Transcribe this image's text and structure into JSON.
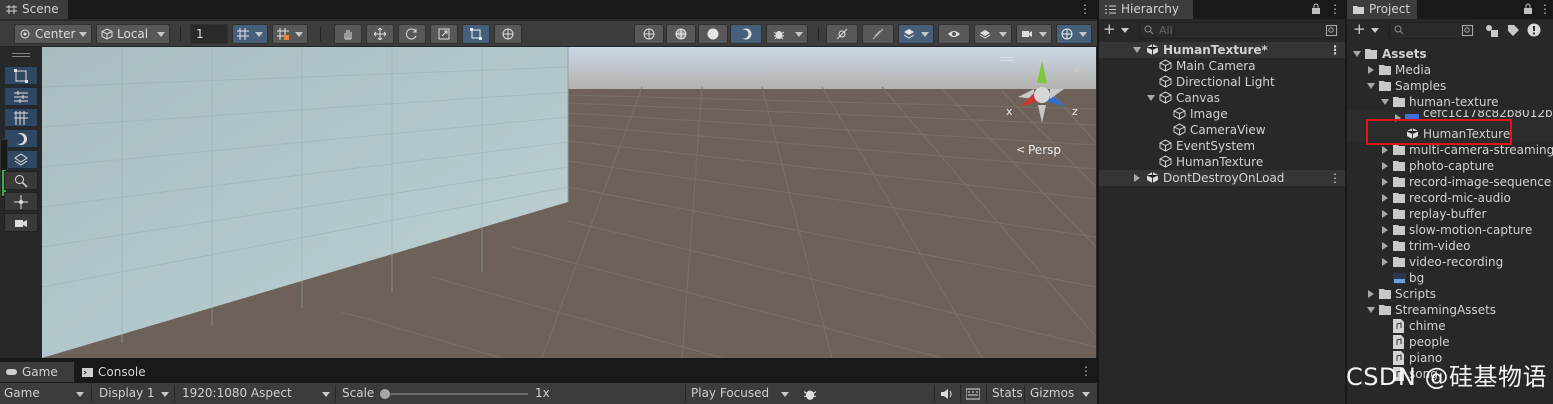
{
  "scene_panel": {
    "tab_label": "Scene",
    "toolbar": {
      "pivot_label": "Center",
      "space_label": "Local",
      "grid_value": "1"
    },
    "gizmo": {
      "x_label": "x",
      "z_label": "z",
      "projection_label": "Persp"
    }
  },
  "game_panel": {
    "tabs": [
      "Game",
      "Console"
    ],
    "bar": {
      "mode": "Game",
      "display": "Display 1",
      "aspect": "1920:1080 Aspect",
      "scale_label": "Scale",
      "scale_value": "1x",
      "play_mode": "Play Focused",
      "stats": "Stats",
      "gizmos": "Gizmos"
    }
  },
  "hierarchy": {
    "tab_label": "Hierarchy",
    "search_placeholder": "All",
    "scene_name": "HumanTexture*",
    "items": [
      {
        "label": "Main Camera"
      },
      {
        "label": "Directional Light"
      },
      {
        "label": "Canvas"
      },
      {
        "label": "Image"
      },
      {
        "label": "CameraView"
      },
      {
        "label": "EventSystem"
      },
      {
        "label": "HumanTexture"
      }
    ],
    "dont_destroy": "DontDestroyOnLoad"
  },
  "project": {
    "tab_label": "Project",
    "tree": [
      {
        "label": "Assets"
      },
      {
        "label": "Media"
      },
      {
        "label": "Samples"
      },
      {
        "label": "human-texture"
      },
      {
        "label": "cefc1c178c82b8012b2"
      },
      {
        "label": "HumanTexture",
        "highlighted": true
      },
      {
        "label": "multi-camera-streaming"
      },
      {
        "label": "photo-capture"
      },
      {
        "label": "record-image-sequence"
      },
      {
        "label": "record-mic-audio"
      },
      {
        "label": "replay-buffer"
      },
      {
        "label": "slow-motion-capture"
      },
      {
        "label": "trim-video"
      },
      {
        "label": "video-recording"
      },
      {
        "label": "bg"
      },
      {
        "label": "Scripts"
      },
      {
        "label": "StreamingAssets"
      },
      {
        "label": "chime"
      },
      {
        "label": "people"
      },
      {
        "label": "piano"
      },
      {
        "label": "song"
      }
    ],
    "highlight_color": "#e0141a"
  },
  "watermark": "CSDN @硅基物语",
  "colors": {
    "accent": "#46607c",
    "panel": "#282828",
    "ground": "#6e615a"
  }
}
